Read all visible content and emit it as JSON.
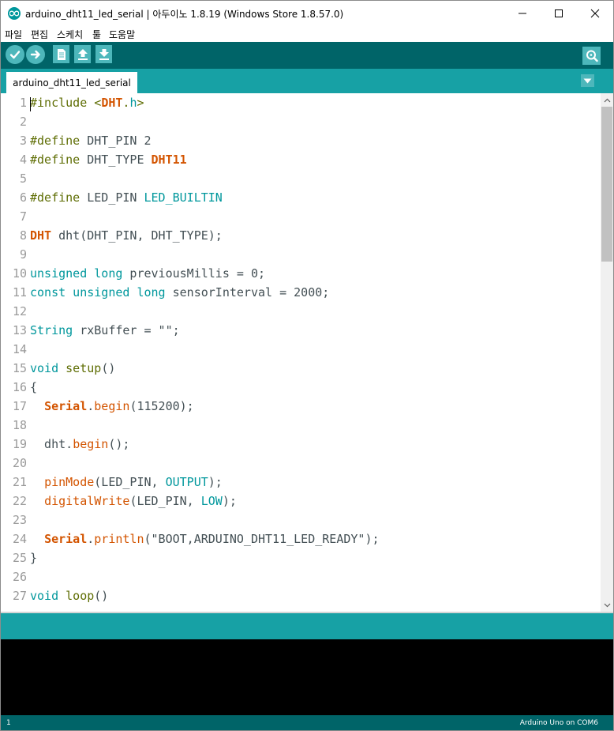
{
  "window": {
    "title": "arduino_dht11_led_serial | 아두이노 1.8.19 (Windows Store 1.8.57.0)",
    "app_icon": "arduino-logo-icon",
    "controls": [
      "minimize-icon",
      "maximize-icon",
      "close-icon"
    ]
  },
  "menu": {
    "items": [
      "파일",
      "편집",
      "스케치",
      "툴",
      "도움말"
    ]
  },
  "toolbar": {
    "buttons": [
      "verify-icon",
      "upload-icon",
      "new-icon",
      "open-icon",
      "save-icon"
    ],
    "right_button": "serial-monitor-icon"
  },
  "tabs": {
    "active_label": "arduino_dht11_led_serial",
    "menu_icon": "tab-dropdown-icon"
  },
  "editor": {
    "line_numbers": [
      "1",
      "2",
      "3",
      "4",
      "5",
      "6",
      "7",
      "8",
      "9",
      "10",
      "11",
      "12",
      "13",
      "14",
      "15",
      "16",
      "17",
      "18",
      "19",
      "20",
      "21",
      "22",
      "23",
      "24",
      "25",
      "26",
      "27"
    ],
    "lines": [
      [
        {
          "t": "#include <",
          "c": "pp"
        },
        {
          "t": "DHT",
          "c": "lib"
        },
        {
          "t": ".",
          "c": "pp"
        },
        {
          "t": "h",
          "c": "kw"
        },
        {
          "t": ">",
          "c": "pp"
        }
      ],
      [],
      [
        {
          "t": "#define",
          "c": "pp"
        },
        {
          "t": " DHT_PIN 2",
          "c": "plain"
        }
      ],
      [
        {
          "t": "#define",
          "c": "pp"
        },
        {
          "t": " DHT_TYPE ",
          "c": "plain"
        },
        {
          "t": "DHT11",
          "c": "lib"
        }
      ],
      [],
      [
        {
          "t": "#define",
          "c": "pp"
        },
        {
          "t": " LED_PIN ",
          "c": "plain"
        },
        {
          "t": "LED_BUILTIN",
          "c": "kw"
        }
      ],
      [],
      [
        {
          "t": "DHT",
          "c": "lib"
        },
        {
          "t": " dht(DHT_PIN, DHT_TYPE);",
          "c": "plain"
        }
      ],
      [],
      [
        {
          "t": "unsigned long",
          "c": "kw"
        },
        {
          "t": " previousMillis = 0;",
          "c": "plain"
        }
      ],
      [
        {
          "t": "const unsigned long",
          "c": "kw"
        },
        {
          "t": " sensorInterval = 2000;",
          "c": "plain"
        }
      ],
      [],
      [
        {
          "t": "String",
          "c": "kw"
        },
        {
          "t": " rxBuffer = \"\";",
          "c": "plain"
        }
      ],
      [],
      [
        {
          "t": "void",
          "c": "kw"
        },
        {
          "t": " ",
          "c": "plain"
        },
        {
          "t": "setup",
          "c": "pp"
        },
        {
          "t": "()",
          "c": "plain"
        }
      ],
      [
        {
          "t": "{",
          "c": "plain"
        }
      ],
      [
        {
          "t": "  ",
          "c": "plain"
        },
        {
          "t": "Serial",
          "c": "lib"
        },
        {
          "t": ".",
          "c": "plain"
        },
        {
          "t": "begin",
          "c": "fn"
        },
        {
          "t": "(115200);",
          "c": "plain"
        }
      ],
      [],
      [
        {
          "t": "  dht.",
          "c": "plain"
        },
        {
          "t": "begin",
          "c": "fn"
        },
        {
          "t": "();",
          "c": "plain"
        }
      ],
      [],
      [
        {
          "t": "  ",
          "c": "plain"
        },
        {
          "t": "pinMode",
          "c": "fn"
        },
        {
          "t": "(LED_PIN, ",
          "c": "plain"
        },
        {
          "t": "OUTPUT",
          "c": "kw"
        },
        {
          "t": ");",
          "c": "plain"
        }
      ],
      [
        {
          "t": "  ",
          "c": "plain"
        },
        {
          "t": "digitalWrite",
          "c": "fn"
        },
        {
          "t": "(LED_PIN, ",
          "c": "plain"
        },
        {
          "t": "LOW",
          "c": "kw"
        },
        {
          "t": ");",
          "c": "plain"
        }
      ],
      [],
      [
        {
          "t": "  ",
          "c": "plain"
        },
        {
          "t": "Serial",
          "c": "lib"
        },
        {
          "t": ".",
          "c": "plain"
        },
        {
          "t": "println",
          "c": "fn"
        },
        {
          "t": "(\"BOOT,ARDUINO_DHT11_LED_READY\");",
          "c": "plain"
        }
      ],
      [
        {
          "t": "}",
          "c": "plain"
        }
      ],
      [],
      [
        {
          "t": "void",
          "c": "kw"
        },
        {
          "t": " ",
          "c": "plain"
        },
        {
          "t": "loop",
          "c": "pp"
        },
        {
          "t": "()",
          "c": "plain"
        }
      ]
    ]
  },
  "status": {
    "line": "1",
    "board": "Arduino Uno on COM6"
  },
  "colors": {
    "toolbar": "#006468",
    "tabbar": "#17a1a5",
    "button": "#4db7bb",
    "console": "#000000"
  }
}
